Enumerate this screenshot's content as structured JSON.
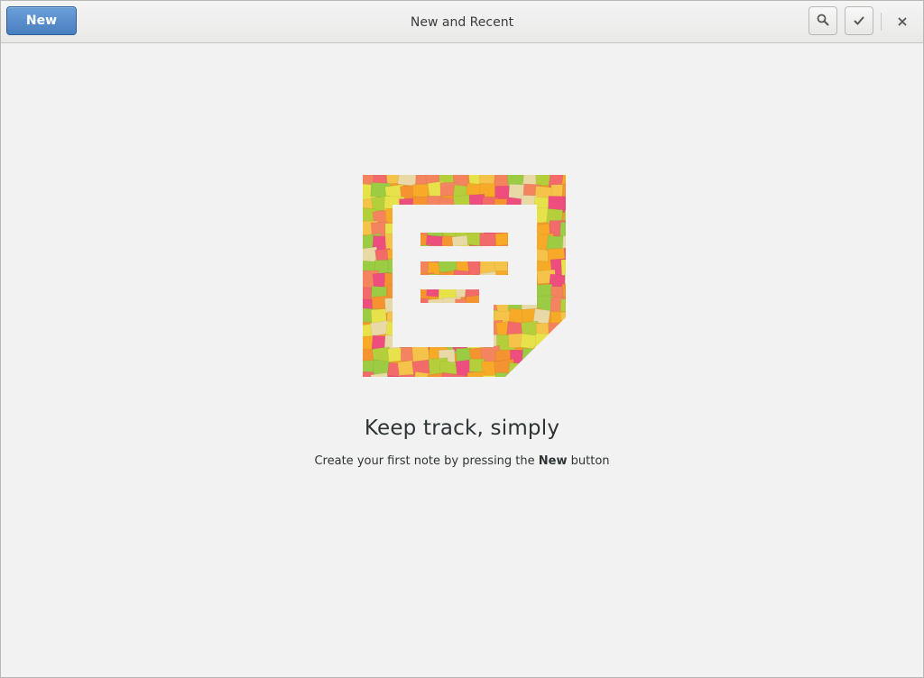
{
  "headerbar": {
    "new_label": "New",
    "title": "New and Recent",
    "search_icon": "search-icon",
    "select_icon": "checkmark-icon",
    "close_icon": "close-icon"
  },
  "empty_state": {
    "heading": "Keep track, simply",
    "subtext_before": "Create your first note by pressing the ",
    "subtext_bold": "New",
    "subtext_after": " button"
  },
  "colors": {
    "accent": "#4a7fc0",
    "background": "#f2f2f2",
    "text": "#2e3436"
  }
}
